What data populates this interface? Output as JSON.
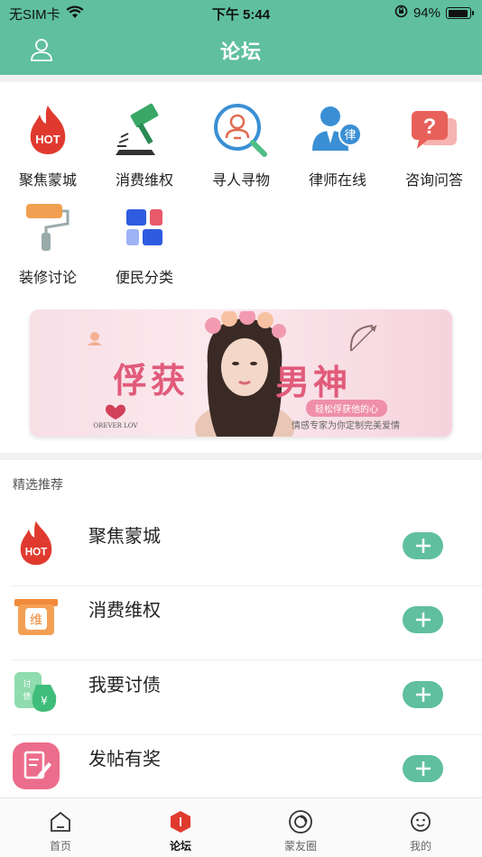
{
  "status_bar": {
    "carrier": "无SIM卡",
    "time": "下午 5:44",
    "battery": "94%",
    "battery_level": 0.94
  },
  "header": {
    "title": "论坛",
    "user_icon": "user-icon"
  },
  "categories": [
    {
      "label": "聚焦蒙城",
      "icon": "hot-flame-icon"
    },
    {
      "label": "消费维权",
      "icon": "gavel-icon"
    },
    {
      "label": "寻人寻物",
      "icon": "magnifier-person-icon"
    },
    {
      "label": "律师在线",
      "icon": "lawyer-icon"
    },
    {
      "label": "咨询问答",
      "icon": "question-bubble-icon"
    },
    {
      "label": "装修讨论",
      "icon": "paint-roller-icon"
    },
    {
      "label": "便民分类",
      "icon": "category-blocks-icon"
    }
  ],
  "banner": {
    "headline_left": "俘获",
    "headline_right": "男神",
    "tag": "轻松俘获他的心",
    "subtitle": "情感专家为你定制完美爱情",
    "corner_text": "FOREVER LOVE"
  },
  "featured": {
    "label": "精选推荐",
    "items": [
      {
        "name": "聚焦蒙城",
        "icon": "hot-flame-icon"
      },
      {
        "name": "消费维权",
        "icon": "rights-badge-icon",
        "icon_text": "维"
      },
      {
        "name": "我要讨债",
        "icon": "debt-money-bag-icon",
        "icon_text": "讨债"
      },
      {
        "name": "发帖有奖",
        "icon": "post-edit-icon"
      }
    ]
  },
  "tabs": [
    {
      "label": "首页",
      "icon": "home-icon",
      "active": false
    },
    {
      "label": "论坛",
      "icon": "forum-icon",
      "active": true
    },
    {
      "label": "蒙友圈",
      "icon": "moments-icon",
      "active": false
    },
    {
      "label": "我的",
      "icon": "profile-icon",
      "active": false
    }
  ],
  "colors": {
    "primary": "#5fbf9f",
    "hot": "#e03a2f",
    "banner_text": "#e15b7a"
  }
}
